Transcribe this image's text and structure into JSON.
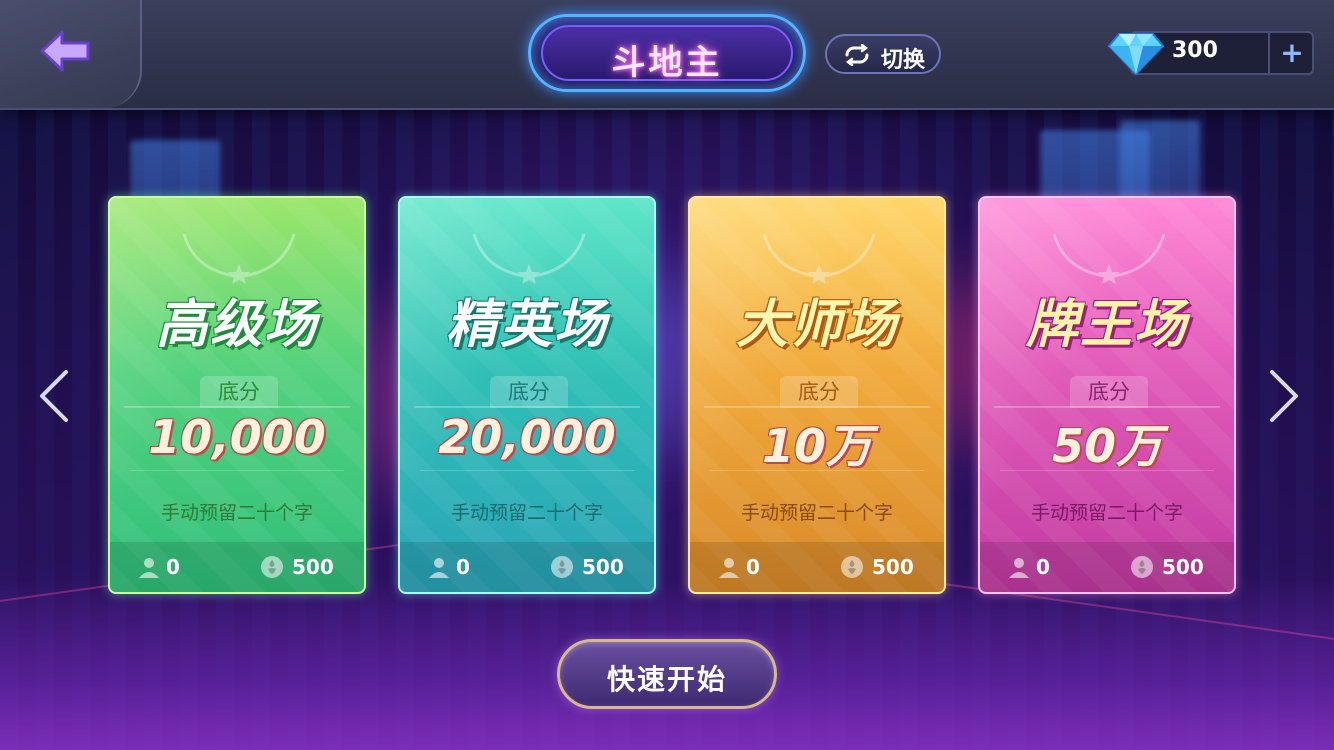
{
  "header": {
    "title": "斗地主",
    "switch_label": "切换",
    "currency": {
      "icon": "diamond-icon",
      "value": "300",
      "add_label": "+"
    }
  },
  "rooms": [
    {
      "name": "高级场",
      "theme": "green",
      "base_label": "底分",
      "base_score": "10,000",
      "description": "手动预留二十个字",
      "players": "0",
      "entry": "500"
    },
    {
      "name": "精英场",
      "theme": "teal",
      "base_label": "底分",
      "base_score": "20,000",
      "description": "手动预留二十个字",
      "players": "0",
      "entry": "500"
    },
    {
      "name": "大师场",
      "theme": "gold",
      "base_label": "底分",
      "base_score": "10万",
      "description": "手动预留二十个字",
      "players": "0",
      "entry": "500"
    },
    {
      "name": "牌王场",
      "theme": "pink",
      "base_label": "底分",
      "base_score": "50万",
      "description": "手动预留二十个字",
      "players": "0",
      "entry": "500"
    }
  ],
  "quick_start_label": "快速开始",
  "colors": {
    "title_glow": "#ff5cf0",
    "frame_blue": "#4fb6ff",
    "green": "#52d17e",
    "teal": "#2fbfb5",
    "gold": "#f0a93a",
    "pink": "#e05ab8"
  }
}
